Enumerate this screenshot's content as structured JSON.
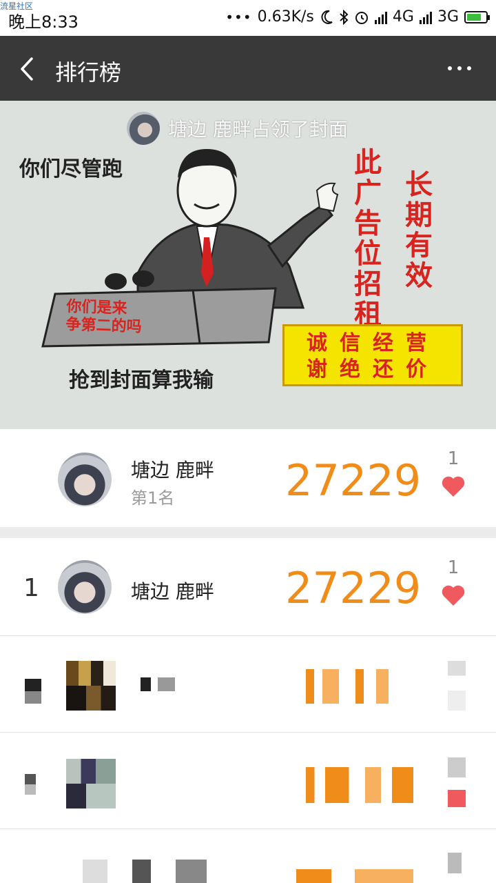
{
  "status_bar": {
    "watermark": "流星社区",
    "time": "晚上8:33",
    "net_speed": "0.63K/s",
    "net1": "4G",
    "net2": "3G",
    "icons": [
      "moon-icon",
      "bluetooth-icon",
      "alarm-icon",
      "signal-icon",
      "battery-charging-icon"
    ]
  },
  "header": {
    "title": "排行榜",
    "back_icon": "chevron-left-icon",
    "more_icon": "more-icon"
  },
  "cover": {
    "caption": "塘边 鹿畔占领了封面",
    "meme": {
      "left_text": "你们尽管跑",
      "bottom_text": "抢到封面算我输",
      "podium_text": "你们是来\n争第二的吗",
      "vertical_1": "此广告位招租",
      "vertical_2": "长期有效",
      "sign_line_1": "诚信经营",
      "sign_line_2": "谢绝还价"
    }
  },
  "my_rank": {
    "name": "塘边 鹿畔",
    "rank_label": "第1名",
    "score": "27229",
    "likes": "1"
  },
  "leaderboard": [
    {
      "rank": "1",
      "name": "塘边 鹿畔",
      "score": "27229",
      "likes": "1"
    }
  ],
  "colors": {
    "score": "#f08c1a",
    "heart": "#f05a5f",
    "header_bg": "#393939"
  }
}
